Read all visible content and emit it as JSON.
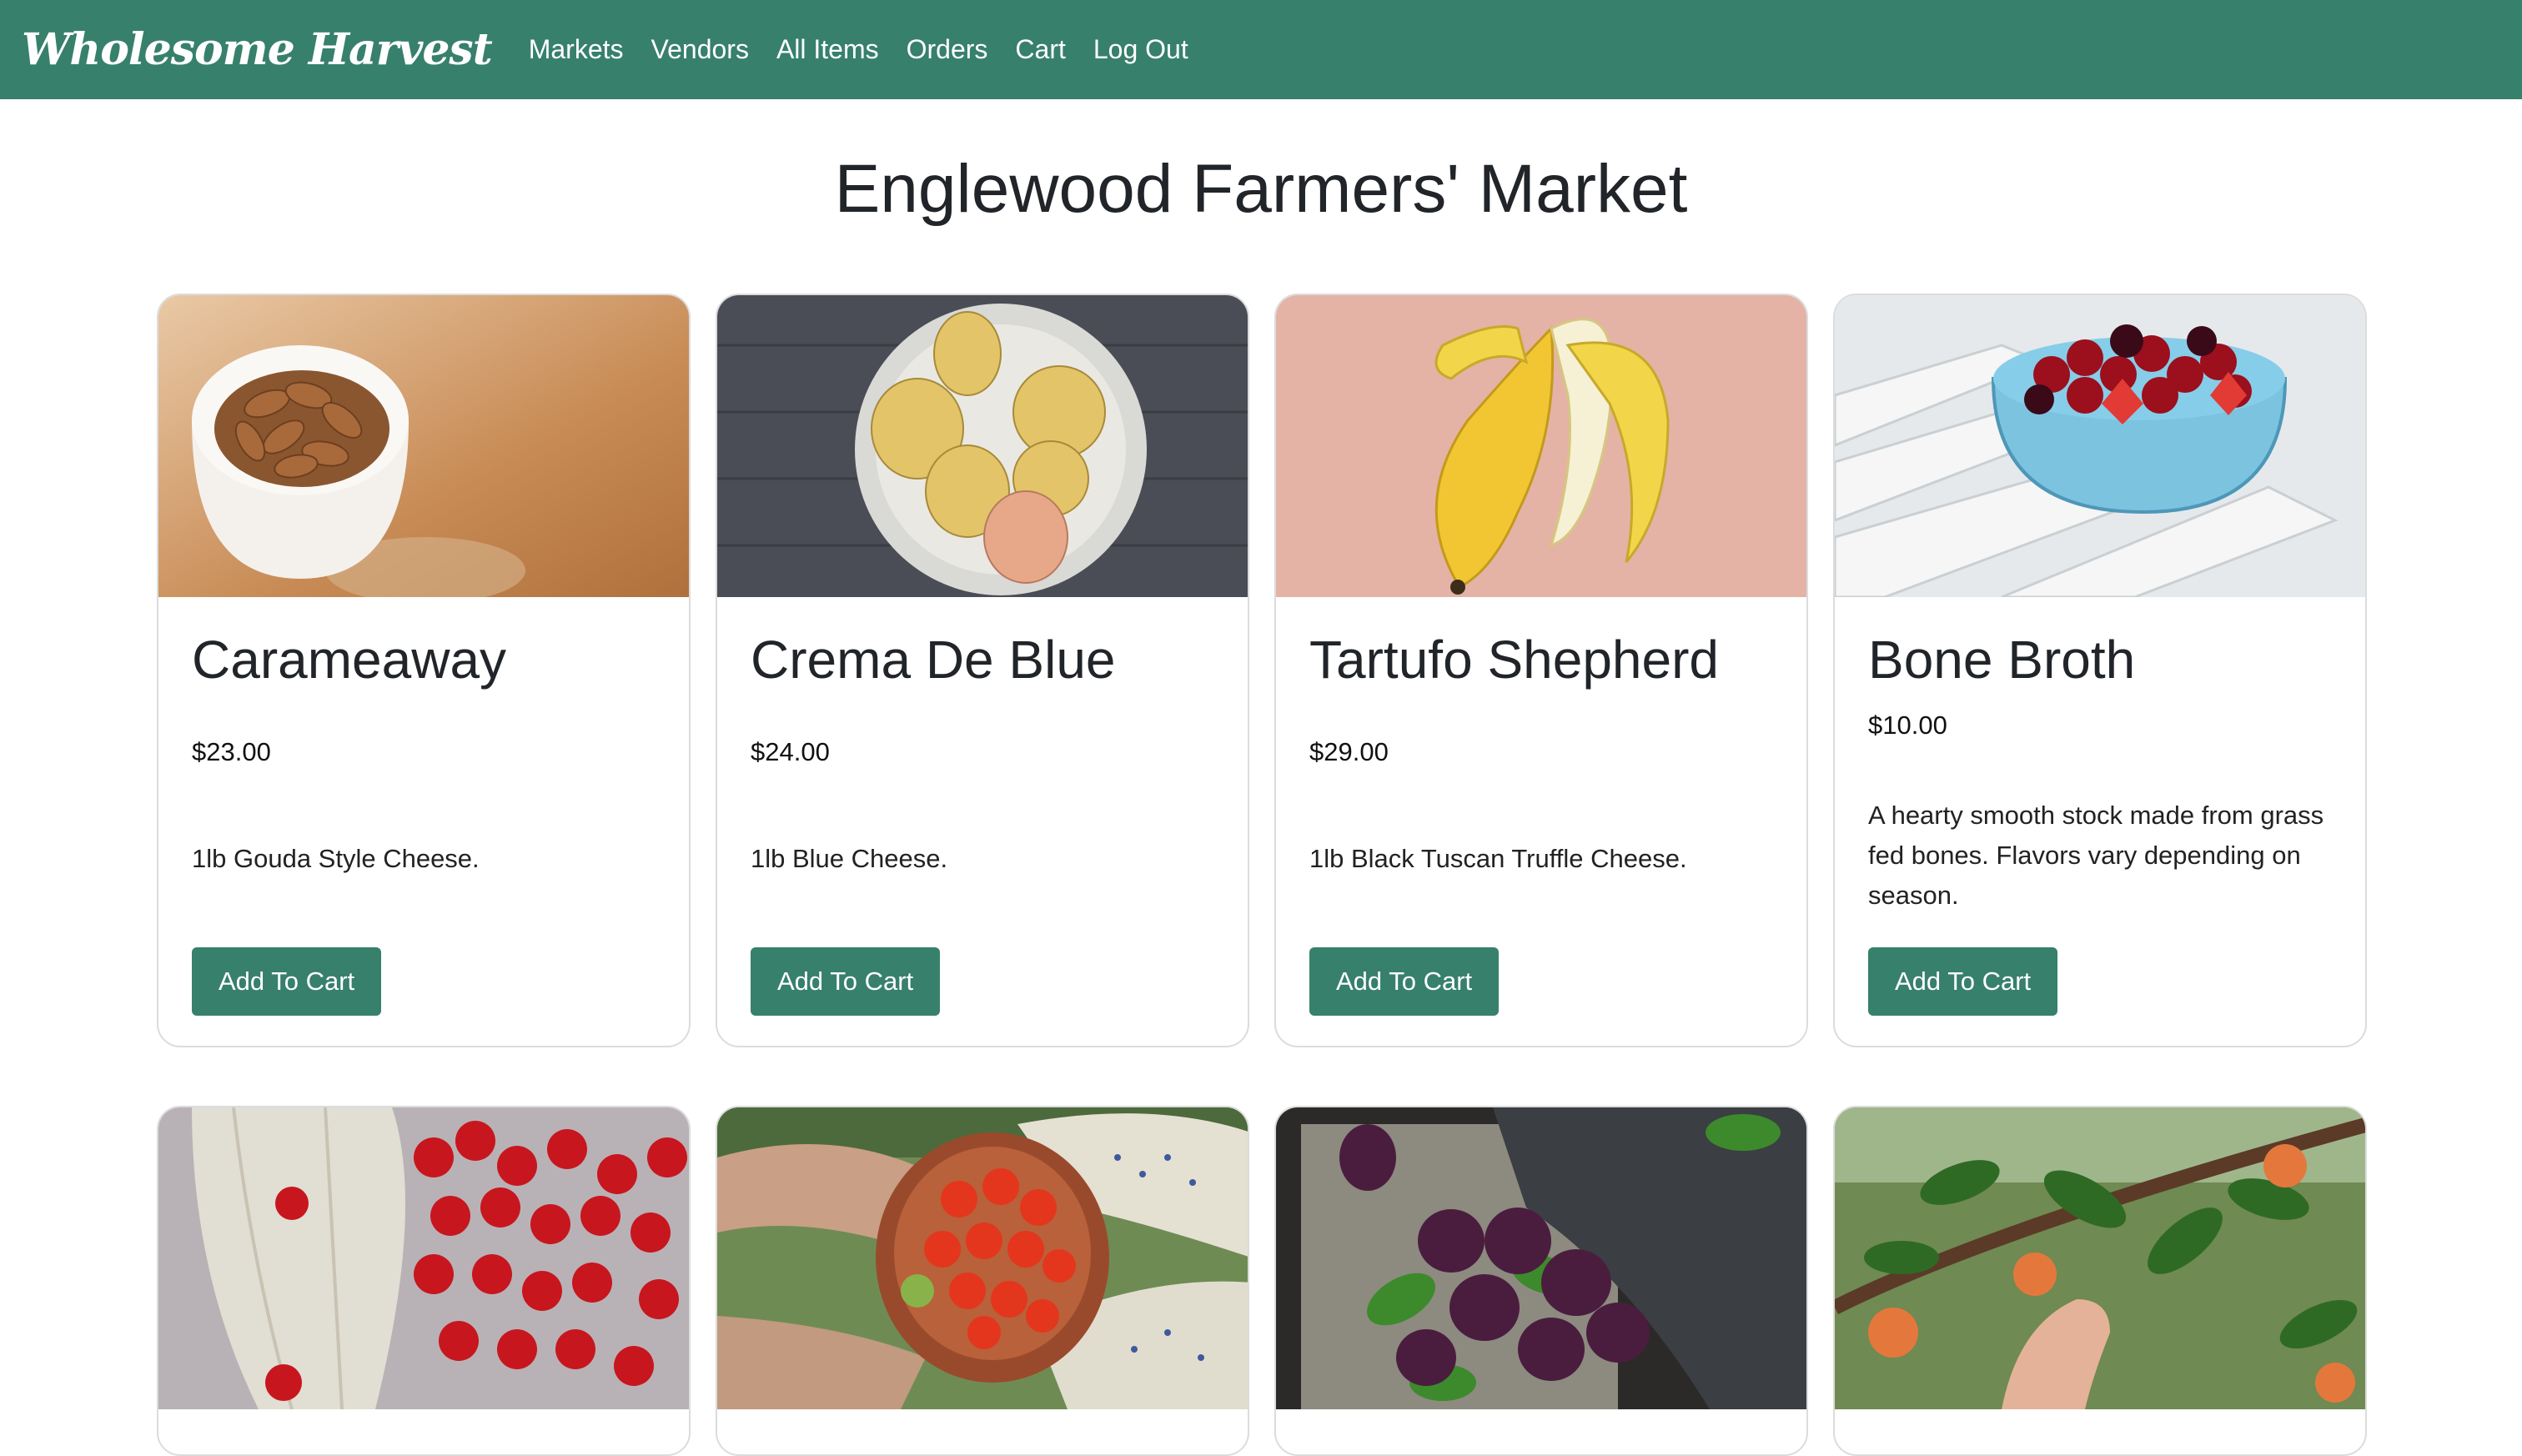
{
  "nav": {
    "brand": "Wholesome Harvest",
    "links": [
      "Markets",
      "Vendors",
      "All Items",
      "Orders",
      "Cart",
      "Log Out"
    ]
  },
  "page": {
    "title": "Englewood Farmers' Market"
  },
  "products": [
    {
      "name": "Carameaway",
      "price": "$23.00",
      "description": "1lb Gouda Style Cheese.",
      "button": "Add To Cart",
      "image": "almonds-in-bowl"
    },
    {
      "name": "Crema De Blue",
      "price": "$24.00",
      "description": "1lb Blue Cheese.",
      "button": "Add To Cart",
      "image": "pears-in-bowl"
    },
    {
      "name": "Tartufo Shepherd",
      "price": "$29.00",
      "description": "1lb Black Tuscan Truffle Cheese.",
      "button": "Add To Cart",
      "image": "peeled-banana"
    },
    {
      "name": "Bone Broth",
      "price": "$10.00",
      "description": "A hearty smooth stock made from grass fed bones. Flavors vary depending on season.",
      "button": "Add To Cart",
      "image": "cherries-strawberries-bowl"
    },
    {
      "image": "cherries-on-cloth"
    },
    {
      "image": "tomatoes-in-hands"
    },
    {
      "image": "plums-on-cloth"
    },
    {
      "image": "apricots-on-tree"
    }
  ],
  "colors": {
    "brand_green": "#37806c",
    "text": "#212529"
  }
}
